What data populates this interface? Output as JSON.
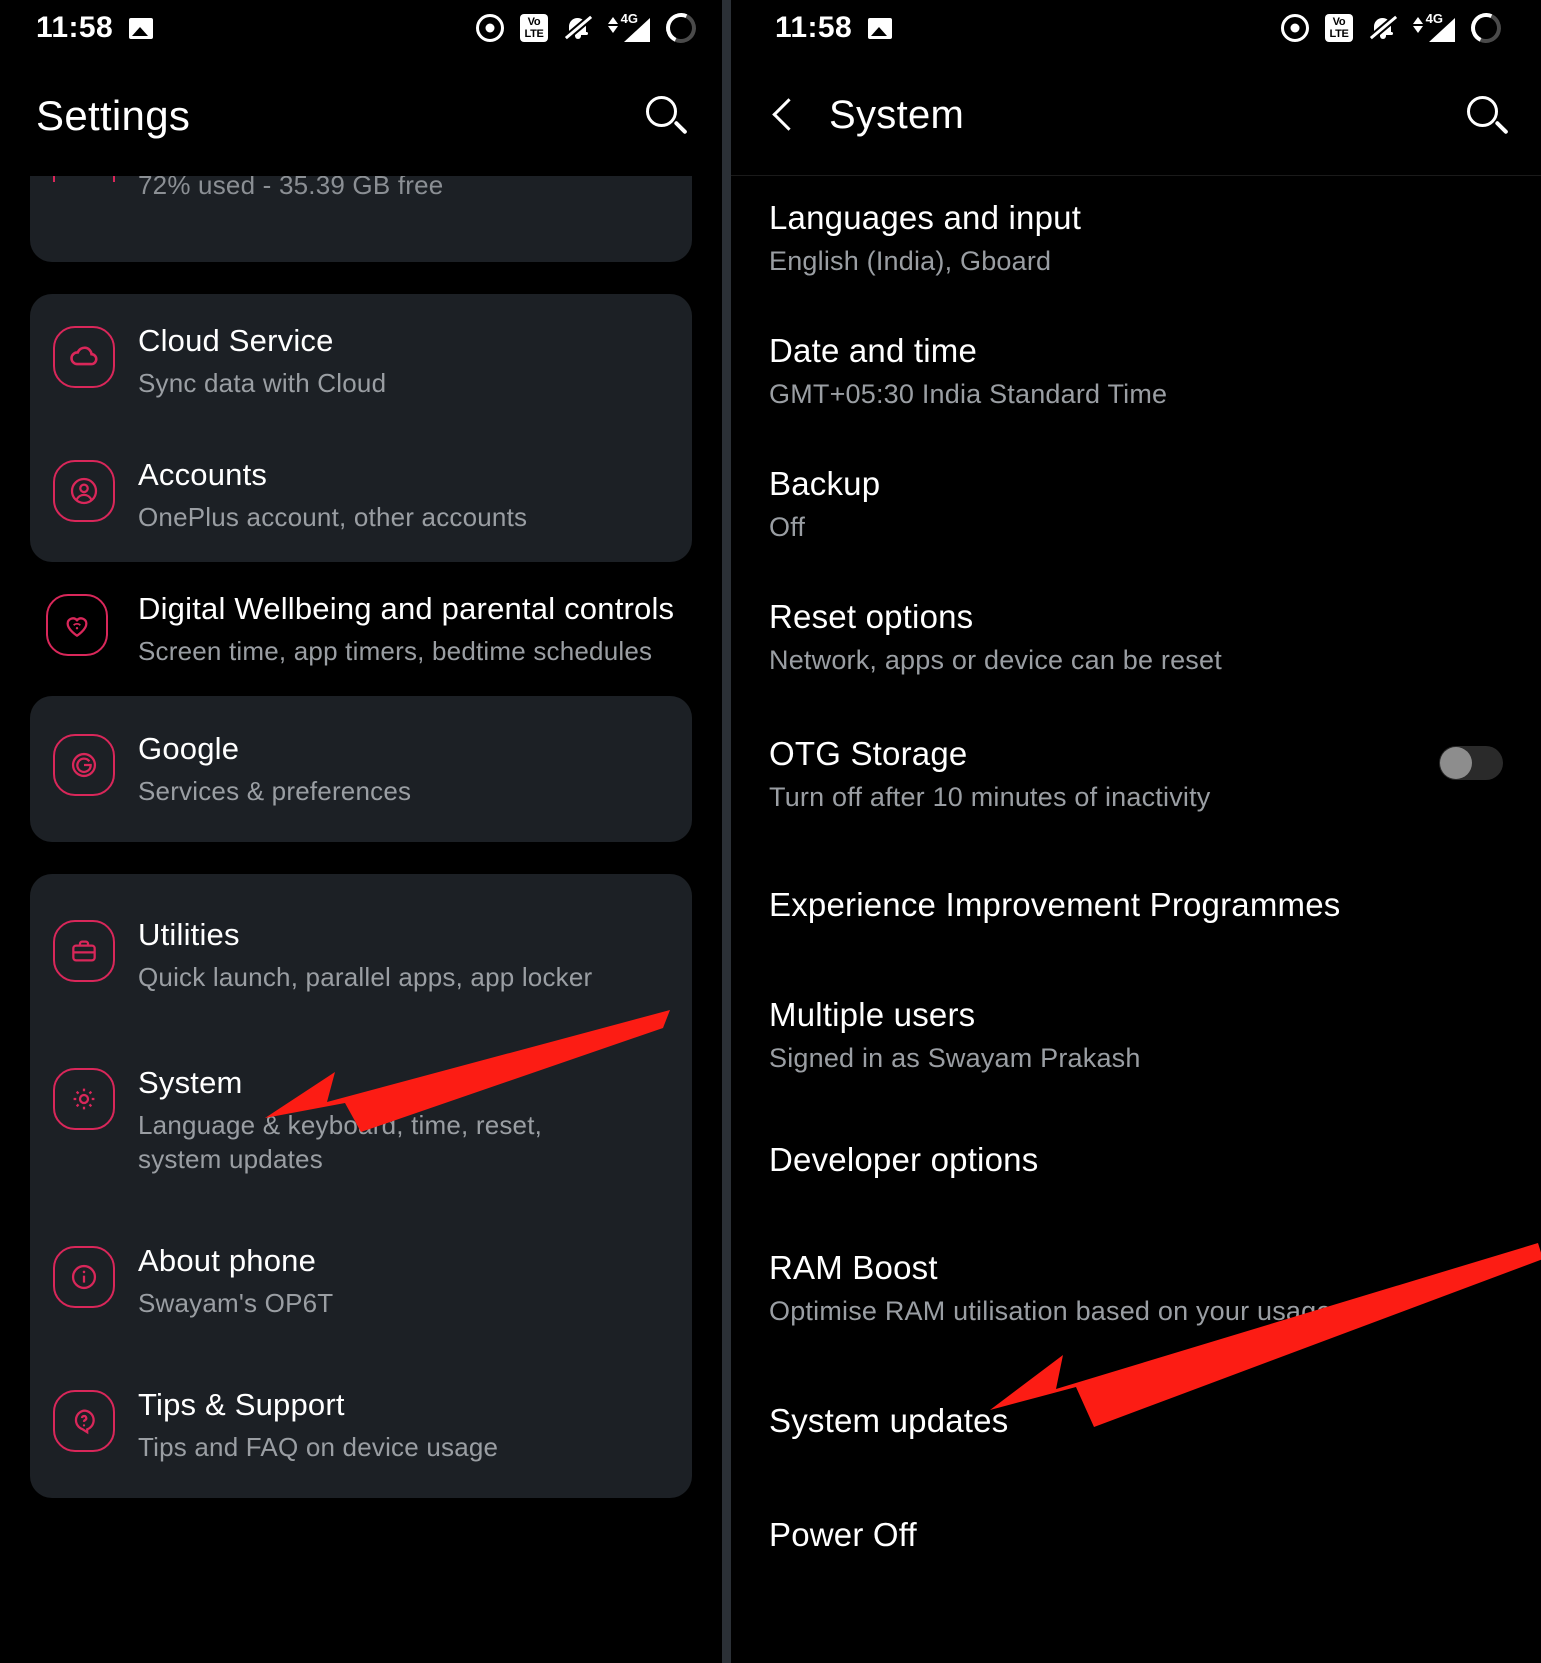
{
  "statusbar": {
    "time": "11:58",
    "icons_left": [
      "image-icon"
    ],
    "icons_right": [
      "nfc-icon",
      "volte-icon",
      "notifications-muted-icon",
      "signal-4g-icon",
      "battery-icon"
    ],
    "volte_top": "Vo",
    "volte_bottom": "LTE",
    "network": "4G"
  },
  "left_screen": {
    "title": "Settings",
    "search_icon": "search-icon",
    "partial_row": {
      "subtitle": "72% used - 35.39 GB free"
    },
    "group_accounts": [
      {
        "icon": "cloud-icon",
        "title": "Cloud Service",
        "subtitle": "Sync data with Cloud"
      },
      {
        "icon": "account-icon",
        "title": "Accounts",
        "subtitle": "OnePlus account, other accounts"
      }
    ],
    "wellbeing": {
      "icon": "heart-icon",
      "title": "Digital Wellbeing and parental controls",
      "subtitle": "Screen time, app timers, bedtime schedules"
    },
    "google": {
      "icon": "google-icon",
      "title": "Google",
      "subtitle": "Services & preferences"
    },
    "group_system": [
      {
        "icon": "briefcase-icon",
        "title": "Utilities",
        "subtitle": "Quick launch, parallel apps, app locker"
      },
      {
        "icon": "gear-icon",
        "title": "System",
        "subtitle": "Language & keyboard, time, reset, system updates"
      },
      {
        "icon": "info-icon",
        "title": "About phone",
        "subtitle": "Swayam's OP6T"
      },
      {
        "icon": "question-icon",
        "title": "Tips & Support",
        "subtitle": "Tips and FAQ on device usage"
      }
    ]
  },
  "right_screen": {
    "back_icon": "back-arrow-icon",
    "title": "System",
    "search_icon": "search-icon",
    "items": [
      {
        "title": "Languages and input",
        "subtitle": "English (India), Gboard"
      },
      {
        "title": "Date and time",
        "subtitle": "GMT+05:30 India Standard Time"
      },
      {
        "title": "Backup",
        "subtitle": "Off"
      },
      {
        "title": "Reset options",
        "subtitle": "Network, apps or device can be reset"
      },
      {
        "title": "OTG Storage",
        "subtitle": "Turn off after 10 minutes of inactivity",
        "toggle": "off"
      },
      {
        "title": "Experience Improvement Programmes",
        "subtitle": ""
      },
      {
        "title": "Multiple users",
        "subtitle": "Signed in as Swayam Prakash"
      },
      {
        "title": "Developer options",
        "subtitle": ""
      },
      {
        "title": "RAM Boost",
        "subtitle": "Optimise RAM utilisation based on your usage"
      },
      {
        "title": "System updates",
        "subtitle": ""
      },
      {
        "title": "Power Off",
        "subtitle": ""
      }
    ]
  },
  "annotations": {
    "arrow_color": "#fc1c14",
    "arrow_left_target": "System",
    "arrow_right_target": "System updates"
  },
  "colors": {
    "accent_pink": "#d9275a",
    "card_background": "#1c2025",
    "page_background": "#000000",
    "secondary_text": "#9a9ea3",
    "arrow_red": "#fc1c14"
  }
}
